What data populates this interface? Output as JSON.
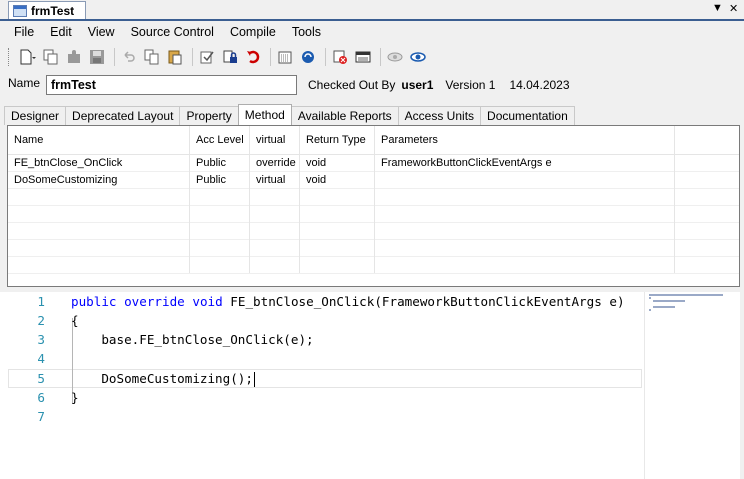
{
  "window": {
    "tab_title": "frmTest",
    "pin_glyph": "▼",
    "close_glyph": "✕"
  },
  "menu": [
    "File",
    "Edit",
    "View",
    "Source Control",
    "Compile",
    "Tools"
  ],
  "toolbar_icons": [
    "new-document-icon",
    "open-icon",
    "puzzle-icon",
    "save-icon",
    "undo-icon",
    "copy-icon",
    "paste-icon",
    "check-icon",
    "lock-icon",
    "revert-icon",
    "list-icon",
    "sync-icon",
    "delete-icon",
    "window-icon",
    "eye-icon",
    "eye-settings-icon"
  ],
  "form": {
    "name_label": "Name",
    "name_value": "frmTest",
    "checked_out_label": "Checked Out By",
    "checked_out_user": "user1",
    "version_label": "Version 1",
    "date": "14.04.2023"
  },
  "tabs": [
    "Designer",
    "Deprecated Layout",
    "Property",
    "Method",
    "Available Reports",
    "Access Units",
    "Documentation"
  ],
  "active_tab": "Method",
  "grid": {
    "columns": [
      "Name",
      "Acc Level",
      "virtual",
      "Return Type",
      "Parameters"
    ],
    "rows": [
      [
        "FE_btnClose_OnClick",
        "Public",
        "override",
        "void",
        "FrameworkButtonClickEventArgs e"
      ],
      [
        "DoSomeCustomizing",
        "Public",
        "virtual",
        "void",
        ""
      ]
    ]
  },
  "code": {
    "line_numbers": [
      "1",
      "2",
      "3",
      "4",
      "5",
      "6",
      "7"
    ],
    "l1_kw1": "public",
    "l1_kw2": "override",
    "l1_kw3": "void",
    "l1_rest": " FE_btnClose_OnClick(FrameworkButtonClickEventArgs e)",
    "l2": "{",
    "l3": "    base.FE_btnClose_OnClick(e);",
    "l4": "",
    "l5": "    DoSomeCustomizing();",
    "l6": "}",
    "l7": ""
  },
  "colors": {
    "keyword": "#0000ff",
    "line_number": "#2b91af",
    "tab_accent": "#3b5e91"
  }
}
